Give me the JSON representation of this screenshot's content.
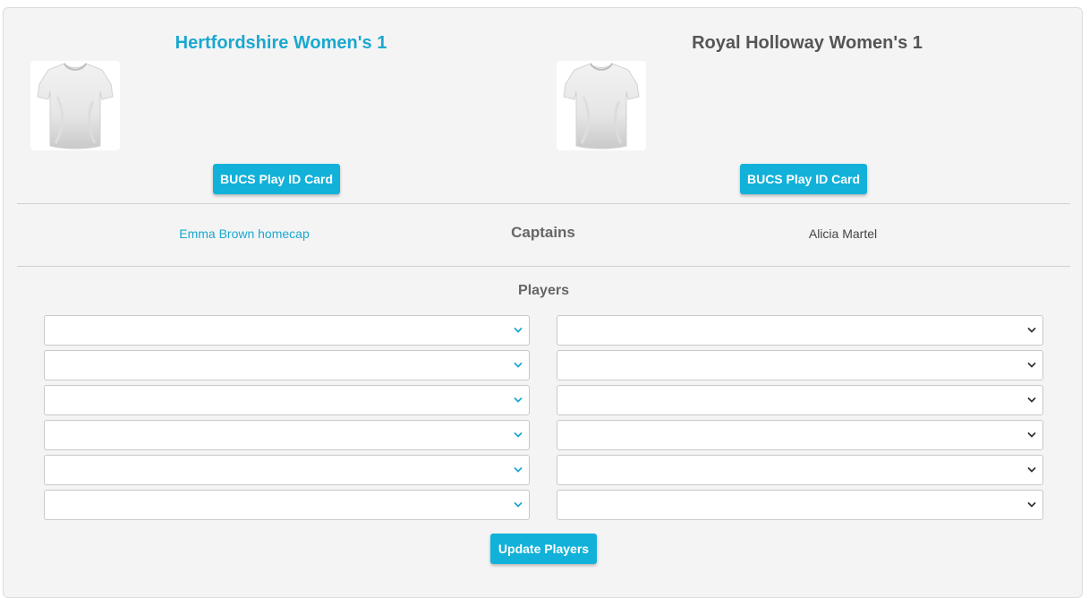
{
  "home": {
    "name": "Hertfordshire Women's 1",
    "kit_icon": "tshirt-icon",
    "id_card_label": "BUCS Play ID Card",
    "captain": "Emma Brown homecap",
    "player_selects": [
      "",
      "",
      "",
      "",
      "",
      ""
    ]
  },
  "away": {
    "name": "Royal Holloway Women's 1",
    "kit_icon": "tshirt-icon",
    "id_card_label": "BUCS Play ID Card",
    "captain": "Alicia Martel",
    "player_selects": [
      "",
      "",
      "",
      "",
      "",
      ""
    ]
  },
  "captains_heading": "Captains",
  "players_heading": "Players",
  "update_button_label": "Update Players",
  "colors": {
    "accent": "#12b1d9",
    "home_name": "#1aa8cf",
    "panel_bg": "#f4f4f4",
    "home_chevron": "#1aa8cf",
    "away_chevron": "#333333"
  }
}
